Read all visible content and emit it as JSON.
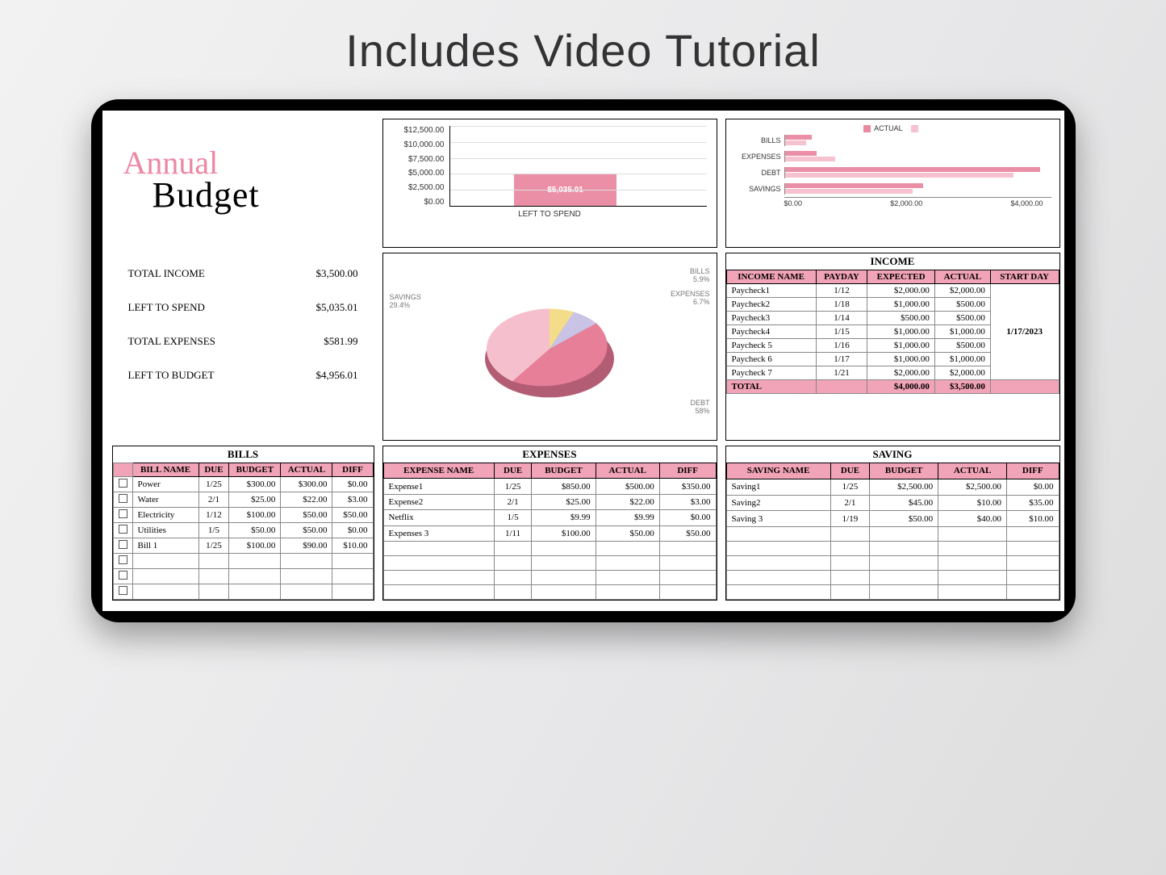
{
  "headline": "Includes Video Tutorial",
  "logo": {
    "script": "Annual",
    "serif": "Budget"
  },
  "chart_data": [
    {
      "type": "bar",
      "title": "",
      "xlabel": "LEFT TO SPEND",
      "ylabel": "",
      "y_ticks": [
        "$12,500.00",
        "$10,000.00",
        "$7,500.00",
        "$5,000.00",
        "$2,500.00",
        "$0.00"
      ],
      "ylim": [
        0,
        12500
      ],
      "categories": [
        "LEFT TO SPEND"
      ],
      "values": [
        5035.01
      ],
      "value_label": "$5,035.01"
    },
    {
      "type": "bar",
      "orientation": "horizontal",
      "legend": [
        "ACTUAL",
        ""
      ],
      "x_ticks": [
        "$0.00",
        "$2,000.00",
        "$4,000.00"
      ],
      "xlim": [
        0,
        5000
      ],
      "categories": [
        "BILLS",
        "EXPENSES",
        "DEBT",
        "SAVINGS"
      ],
      "series": [
        {
          "name": "ACTUAL",
          "values": [
            500,
            600,
            4800,
            2600
          ]
        },
        {
          "name": "",
          "values": [
            400,
            950,
            4300,
            2400
          ]
        }
      ]
    },
    {
      "type": "pie",
      "slices": [
        {
          "label": "BILLS",
          "pct": 5.9
        },
        {
          "label": "EXPENSES",
          "pct": 6.7
        },
        {
          "label": "DEBT",
          "pct": 58.0
        },
        {
          "label": "SAVINGS",
          "pct": 29.4
        }
      ]
    }
  ],
  "summary": [
    {
      "label": "TOTAL INCOME",
      "value": "$3,500.00"
    },
    {
      "label": "LEFT TO SPEND",
      "value": "$5,035.01"
    },
    {
      "label": "TOTAL EXPENSES",
      "value": "$581.99"
    },
    {
      "label": "LEFT TO BUDGET",
      "value": "$4,956.01"
    }
  ],
  "income": {
    "title": "INCOME",
    "headers": [
      "INCOME NAME",
      "PAYDAY",
      "EXPECTED",
      "ACTUAL",
      "START DAY"
    ],
    "start_day": "1/17/2023",
    "rows": [
      [
        "Paycheck1",
        "1/12",
        "$2,000.00",
        "$2,000.00"
      ],
      [
        "Paycheck2",
        "1/18",
        "$1,000.00",
        "$500.00"
      ],
      [
        "Paycheck3",
        "1/14",
        "$500.00",
        "$500.00"
      ],
      [
        "Paycheck4",
        "1/15",
        "$1,000.00",
        "$1,000.00"
      ],
      [
        "Paycheck 5",
        "1/16",
        "$1,000.00",
        "$500.00"
      ],
      [
        "Paycheck 6",
        "1/17",
        "$1,000.00",
        "$1,000.00"
      ],
      [
        "Paycheck 7",
        "1/21",
        "$2,000.00",
        "$2,000.00"
      ]
    ],
    "total": [
      "TOTAL",
      "",
      "$4,000.00",
      "$3,500.00",
      ""
    ]
  },
  "bills": {
    "title": "BILLS",
    "headers": [
      "BILL NAME",
      "DUE",
      "BUDGET",
      "ACTUAL",
      "DIFF"
    ],
    "rows": [
      [
        "Power",
        "1/25",
        "$300.00",
        "$300.00",
        "$0.00"
      ],
      [
        "Water",
        "2/1",
        "$25.00",
        "$22.00",
        "$3.00"
      ],
      [
        "Electricity",
        "1/12",
        "$100.00",
        "$50.00",
        "$50.00"
      ],
      [
        "Utilities",
        "1/5",
        "$50.00",
        "$50.00",
        "$0.00"
      ],
      [
        "Bill 1",
        "1/25",
        "$100.00",
        "$90.00",
        "$10.00"
      ]
    ],
    "empty_rows": 3
  },
  "expenses": {
    "title": "EXPENSES",
    "headers": [
      "EXPENSE NAME",
      "DUE",
      "BUDGET",
      "ACTUAL",
      "DIFF"
    ],
    "rows": [
      [
        "Expense1",
        "1/25",
        "$850.00",
        "$500.00",
        "$350.00"
      ],
      [
        "Expense2",
        "2/1",
        "$25.00",
        "$22.00",
        "$3.00"
      ],
      [
        "Netflix",
        "1/5",
        "$9.99",
        "$9.99",
        "$0.00"
      ],
      [
        "Expenses 3",
        "1/11",
        "$100.00",
        "$50.00",
        "$50.00"
      ]
    ],
    "empty_rows": 4
  },
  "saving": {
    "title": "SAVING",
    "headers": [
      "SAVING NAME",
      "DUE",
      "BUDGET",
      "ACTUAL",
      "DIFF"
    ],
    "rows": [
      [
        "Saving1",
        "1/25",
        "$2,500.00",
        "$2,500.00",
        "$0.00"
      ],
      [
        "Saving2",
        "2/1",
        "$45.00",
        "$10.00",
        "$35.00"
      ],
      [
        "Saving 3",
        "1/19",
        "$50.00",
        "$40.00",
        "$10.00"
      ]
    ],
    "empty_rows": 5
  }
}
